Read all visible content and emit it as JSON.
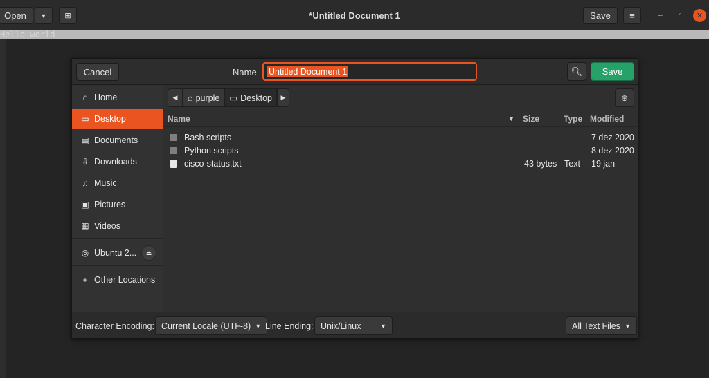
{
  "window": {
    "title": "*Untitled Document 1",
    "open_label": "Open",
    "save_label": "Save",
    "editor_text": "Hello world"
  },
  "dialog": {
    "cancel_label": "Cancel",
    "name_label": "Name",
    "name_value": "Untitled Document 1",
    "save_label": "Save",
    "sidebar": {
      "items": [
        {
          "label": "Home",
          "icon": "home-icon"
        },
        {
          "label": "Desktop",
          "icon": "desktop-icon"
        },
        {
          "label": "Documents",
          "icon": "documents-icon"
        },
        {
          "label": "Downloads",
          "icon": "downloads-icon"
        },
        {
          "label": "Music",
          "icon": "music-icon"
        },
        {
          "label": "Pictures",
          "icon": "pictures-icon"
        },
        {
          "label": "Videos",
          "icon": "videos-icon"
        },
        {
          "label": "Ubuntu 2...",
          "icon": "disk-icon"
        },
        {
          "label": "Other Locations",
          "icon": "plus-icon"
        }
      ]
    },
    "pathbar": {
      "segments": [
        "purple",
        "Desktop"
      ]
    },
    "columns": {
      "name": "Name",
      "size": "Size",
      "type": "Type",
      "modified": "Modified"
    },
    "files": [
      {
        "name": "Bash scripts",
        "size": "",
        "type": "",
        "modified": "7 dez 2020",
        "kind": "folder"
      },
      {
        "name": "Python scripts",
        "size": "",
        "type": "",
        "modified": "8 dez 2020",
        "kind": "folder"
      },
      {
        "name": "cisco-status.txt",
        "size": "43 bytes",
        "type": "Text",
        "modified": "19 jan",
        "kind": "file"
      }
    ],
    "footer": {
      "encoding_label": "Character Encoding:",
      "encoding_value": "Current Locale (UTF-8)",
      "line_ending_label": "Line Ending:",
      "line_ending_value": "Unix/Linux",
      "filter_value": "All Text Files"
    }
  },
  "colors": {
    "accent": "#e95420",
    "save_green": "#26a269"
  }
}
